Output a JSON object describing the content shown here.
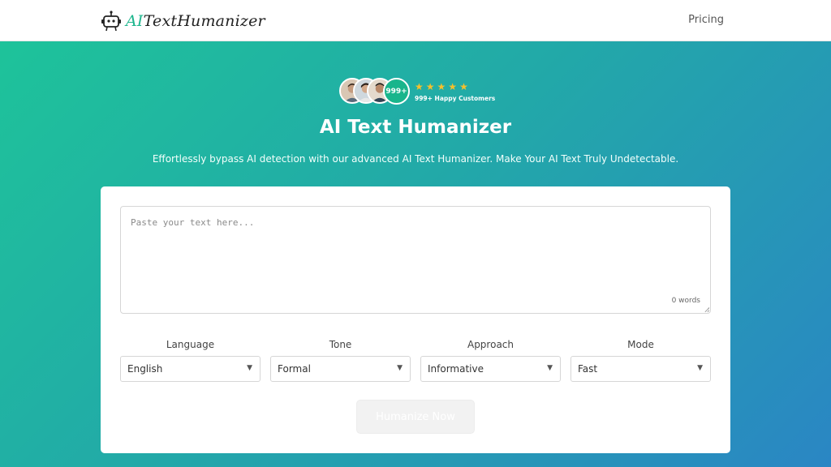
{
  "header": {
    "logo_ai": "AI",
    "logo_rest": "TextHumanizer",
    "nav_pricing": "Pricing"
  },
  "hero": {
    "badge_count": "999+",
    "rating_stars": 5,
    "customers_text": "999+ Happy Customers",
    "title": "AI Text Humanizer",
    "subtitle": "Effortlessly bypass AI detection with our advanced AI Text Humanizer. Make Your AI Text Truly Undetectable."
  },
  "editor": {
    "placeholder": "Paste your text here...",
    "value": "",
    "word_count": "0 words"
  },
  "selectors": [
    {
      "label": "Language",
      "value": "English"
    },
    {
      "label": "Tone",
      "value": "Formal"
    },
    {
      "label": "Approach",
      "value": "Informative"
    },
    {
      "label": "Mode",
      "value": "Fast"
    }
  ],
  "actions": {
    "humanize_label": "Humanize Now"
  },
  "colors": {
    "brand_green": "#1fb68e",
    "gradient_start": "#1ec39a",
    "gradient_end": "#2a86c4",
    "star": "#f6c02c"
  },
  "icons": [
    "robot-logo-icon",
    "star-icon",
    "chevron-down-icon"
  ]
}
